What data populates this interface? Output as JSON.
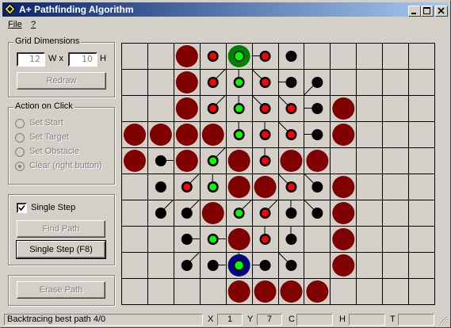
{
  "window": {
    "title": "A+ Pathfinding Algorithm"
  },
  "menu": {
    "items": [
      "File",
      "?"
    ]
  },
  "grid_dimensions": {
    "legend": "Grid Dimensions",
    "width_value": "12",
    "w_label": "W x",
    "height_value": "10",
    "h_label": "H",
    "redraw_label": "Redraw"
  },
  "action_on_click": {
    "legend": "Action on Click",
    "options": [
      "Set Start",
      "Set Target",
      "Set Obstacle",
      "Clear (right button)"
    ],
    "selected": "Clear (right button)"
  },
  "single_step": {
    "checkbox_label": "Single Step",
    "checked": true
  },
  "buttons": {
    "find_path": "Find Path",
    "single_step": "Single Step (F8)",
    "erase_path": "Erase Path"
  },
  "status": {
    "message": "Backtracing best path 4/0",
    "x_label": "X",
    "x_value": "1",
    "y_label": "Y",
    "y_value": "7",
    "c_label": "C",
    "c_value": "",
    "h_label": "H",
    "h_value": "",
    "t_label": "T",
    "t_value": ""
  },
  "grid": {
    "cols": 12,
    "rows": 10,
    "colors": {
      "obstacle": "#800000",
      "start": "#008000",
      "target": "#000080",
      "open": "#ff0000",
      "path": "#00ff00",
      "closed": "#000000",
      "grid_line": "#000000",
      "background": "#d4d0c8"
    },
    "cells": [
      [
        "",
        "",
        "O",
        "R",
        "S",
        "R",
        "B",
        "",
        "",
        "",
        "",
        ""
      ],
      [
        "",
        "",
        "O",
        "R",
        "G",
        "R",
        "B",
        "B",
        "",
        "",
        "",
        ""
      ],
      [
        "",
        "",
        "O",
        "R",
        "G",
        "R",
        "R",
        "B",
        "O",
        "",
        "",
        ""
      ],
      [
        "O",
        "O",
        "O",
        "O",
        "G",
        "R",
        "R",
        "B",
        "O",
        "",
        "",
        ""
      ],
      [
        "O",
        "B",
        "O",
        "G",
        "O",
        "R",
        "O",
        "O",
        "",
        "",
        "",
        ""
      ],
      [
        "",
        "B",
        "R",
        "G",
        "O",
        "O",
        "R",
        "B",
        "O",
        "",
        "",
        ""
      ],
      [
        "",
        "B",
        "B",
        "O",
        "G",
        "R",
        "B",
        "B",
        "O",
        "",
        "",
        ""
      ],
      [
        "",
        "",
        "B",
        "G",
        "O",
        "R",
        "B",
        "",
        "O",
        "",
        "",
        ""
      ],
      [
        "",
        "",
        "B",
        "B",
        "T",
        "B",
        "B",
        "",
        "O",
        "",
        "",
        ""
      ],
      [
        "",
        "",
        "",
        "",
        "O",
        "O",
        "O",
        "O",
        "",
        "",
        "",
        ""
      ]
    ],
    "parents": [
      [
        "",
        "",
        "",
        "",
        "",
        "W",
        "",
        "",
        "",
        "",
        "",
        ""
      ],
      [
        "",
        "",
        "",
        "NE",
        "N",
        "NW",
        "W",
        "SW",
        "",
        "",
        "",
        ""
      ],
      [
        "",
        "",
        "",
        "NE",
        "N",
        "NW",
        "NW",
        "W",
        "",
        "",
        "",
        ""
      ],
      [
        "",
        "",
        "",
        "",
        "N",
        "N",
        "NW",
        "W",
        "",
        "",
        "",
        ""
      ],
      [
        "",
        "E",
        "",
        "NE",
        "",
        "N",
        "",
        "",
        "",
        "",
        "",
        ""
      ],
      [
        "",
        "",
        "NE",
        "N",
        "",
        "",
        "NW",
        "NW",
        "",
        "",
        "",
        ""
      ],
      [
        "",
        "NE",
        "NE",
        "",
        "NE",
        "NE",
        "N",
        "NW",
        "",
        "",
        "",
        ""
      ],
      [
        "",
        "",
        "E",
        "E",
        "",
        "N",
        "N",
        "",
        "",
        "",
        "",
        ""
      ],
      [
        "",
        "",
        "NE",
        "E",
        "N",
        "W",
        "NW",
        "",
        "",
        "",
        "",
        ""
      ],
      [
        "",
        "",
        "",
        "",
        "",
        "",
        "",
        "",
        "",
        "",
        "",
        ""
      ]
    ]
  }
}
